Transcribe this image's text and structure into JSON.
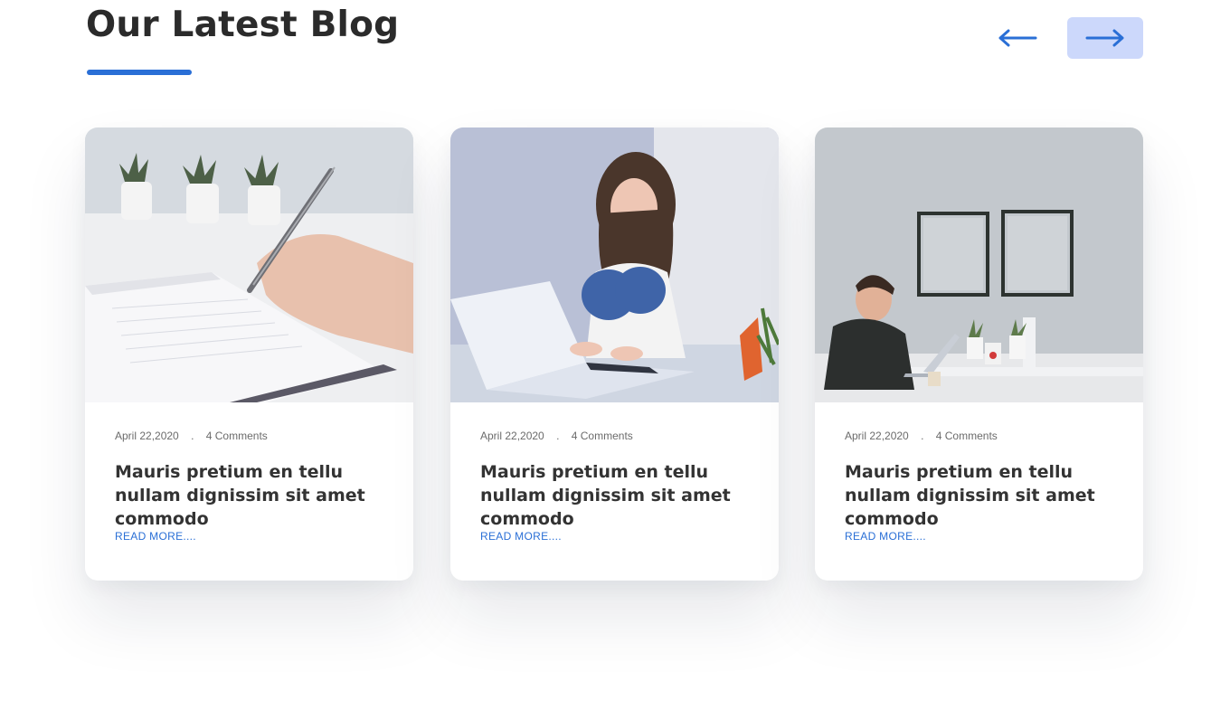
{
  "section": {
    "title": "Our Latest Blog",
    "accent_color": "#2a6fd6"
  },
  "nav": {
    "prev_icon": "arrow-left-icon",
    "next_icon": "arrow-right-icon",
    "next_active_bg": "#ccd8fb"
  },
  "posts": [
    {
      "image": "hand-writing-notebook-photo",
      "date": "April 22,2020",
      "separator": ".",
      "comments": "4 Comments",
      "title": "Mauris pretium en tellu nullam dignissim sit amet commodo",
      "read_more": "READ MORE...."
    },
    {
      "image": "woman-on-laptop-photo",
      "date": "April 22,2020",
      "separator": ".",
      "comments": "4 Comments",
      "title": "Mauris pretium en tellu nullam dignissim sit amet commodo",
      "read_more": "READ MORE...."
    },
    {
      "image": "man-working-at-desk-photo",
      "date": "April 22,2020",
      "separator": ".",
      "comments": "4 Comments",
      "title": "Mauris pretium en tellu nullam dignissim sit amet commodo",
      "read_more": "READ MORE...."
    }
  ]
}
